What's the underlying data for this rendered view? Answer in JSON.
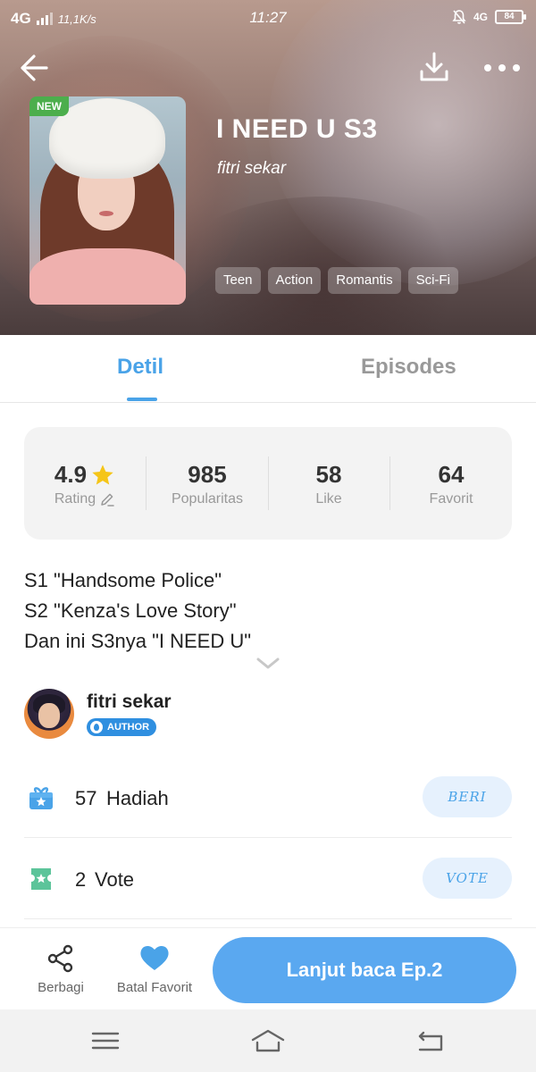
{
  "status_bar": {
    "network": "4G",
    "speed": "11,1K/s",
    "time": "11:27",
    "network_right": "4G",
    "battery": "84"
  },
  "book": {
    "badge": "NEW",
    "title": "I NEED U S3",
    "author": "fitri sekar",
    "tags": [
      "Teen",
      "Action",
      "Romantis",
      "Sci-Fi"
    ]
  },
  "tabs": {
    "detil": "Detil",
    "episodes": "Episodes",
    "active": "detil"
  },
  "stats": {
    "rating_value": "4.9",
    "rating_label": "Rating",
    "popularity_value": "985",
    "popularity_label": "Popularitas",
    "like_value": "58",
    "like_label": "Like",
    "favorite_value": "64",
    "favorite_label": "Favorit"
  },
  "description": {
    "line1": "S1 \"Handsome Police\"",
    "line2": "S2 \"Kenza's Love Story\"",
    "line3": "Dan ini S3nya \"I NEED U\""
  },
  "author": {
    "name": "fitri sekar",
    "badge": "AUTHOR"
  },
  "gift": {
    "count": "57",
    "label": "Hadiah",
    "button": "BERI"
  },
  "vote": {
    "count": "2",
    "label": "Vote",
    "button": "VOTE"
  },
  "bottom_bar": {
    "share_label": "Berbagi",
    "favorite_label": "Batal Favorit",
    "read_button": "Lanjut baca Ep.2"
  },
  "colors": {
    "accent": "#4aa3e8",
    "primary_button": "#5aa8f0",
    "new_badge": "#4cae4c",
    "star": "#f5c518",
    "gift_icon": "#4aa3e8",
    "vote_icon": "#5cc49a"
  },
  "icons": {
    "back": "arrow-left-icon",
    "download": "download-icon",
    "more": "more-dots-icon",
    "star": "star-icon",
    "edit": "pencil-icon",
    "expand": "chevron-down-icon",
    "gift": "gift-icon",
    "vote": "ticket-icon",
    "share": "share-icon",
    "favorite": "heart-icon",
    "nav_menu": "menu-icon",
    "nav_home": "home-icon",
    "nav_back": "return-icon"
  }
}
